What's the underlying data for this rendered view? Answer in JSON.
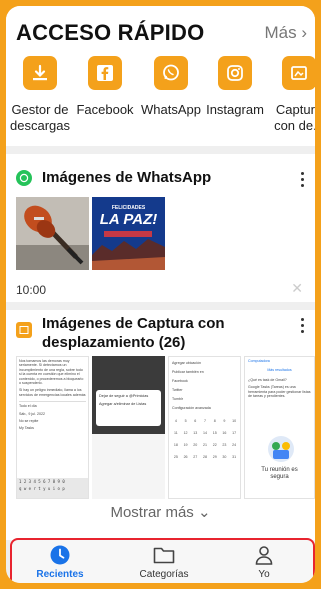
{
  "quick_access": {
    "title": "ACCESO RÁPIDO",
    "more": "Más",
    "items": [
      {
        "label": "Gestor de\ndescargas",
        "icon": "download-icon"
      },
      {
        "label": "Facebook",
        "icon": "facebook-icon"
      },
      {
        "label": "WhatsApp",
        "icon": "whatsapp-icon"
      },
      {
        "label": "Instagram",
        "icon": "instagram-icon"
      },
      {
        "label": "Captura\ncon de...",
        "icon": "screenshot-icon"
      }
    ]
  },
  "whatsapp_card": {
    "title": "Imágenes de WhatsApp",
    "time": "10:00",
    "thumb2_line1": "FELICIDADES",
    "thumb2_line2": "LA PAZ!"
  },
  "scroll_card": {
    "title": "Imágenes de Captura con desplazamiento (26)",
    "thumb_text": {
      "t1": "Nos tomamos las demoras muy seriamente. Si detectamos un incumplimiento de una regla, sobre todo si la cuenta en cuestión que elimino el contenido, o procederemos a bloquearlo o suspenderlo.",
      "t1b": "Si hay un peligro inmediato, llama a los servicios de emergencias locales además",
      "t1_row1": "Todo el día",
      "t1_row2": "Sáb., 9 jul. 2022",
      "t1_row3": "No se repite",
      "t1_row4": "My Tasks",
      "t1_keys1": "1 2 3 4 5 6 7 8 9 0",
      "t1_keys2": "q w e r t y u i o p",
      "t2_item1": "Dejar de seguir a @Primicias",
      "t2_item2": "Agregar a/eliminar de Listas",
      "t3_item1": "Agregar ubicación",
      "t3_item2": "Publicar también en",
      "t3_item3": "Facebook",
      "t3_item4": "Twitter",
      "t3_item5": "Tumblr",
      "t3_item6": "Configuración avanzada",
      "t4_title": "Computadora",
      "t4_link": "Más resultados",
      "t4_q": "¿Qué es task de Gmail?",
      "t4_body": "Google Tasks (Tareas) es una herramienta para poder gestionar listas de tareas y pendientes.",
      "t4_meet1": "Tu reunión es",
      "t4_meet2": "segura"
    },
    "calendar_days": [
      "4",
      "5",
      "6",
      "7",
      "8",
      "9",
      "10",
      "11",
      "12",
      "13",
      "14",
      "15",
      "16",
      "17",
      "18",
      "19",
      "20",
      "21",
      "22",
      "23",
      "24",
      "25",
      "26",
      "27",
      "28",
      "29",
      "30",
      "31"
    ]
  },
  "show_more": "Mostrar más",
  "bottom_nav": [
    {
      "label": "Recientes",
      "icon": "clock-icon",
      "active": true
    },
    {
      "label": "Categorías",
      "icon": "folder-icon",
      "active": false
    },
    {
      "label": "Yo",
      "icon": "person-icon",
      "active": false
    }
  ]
}
